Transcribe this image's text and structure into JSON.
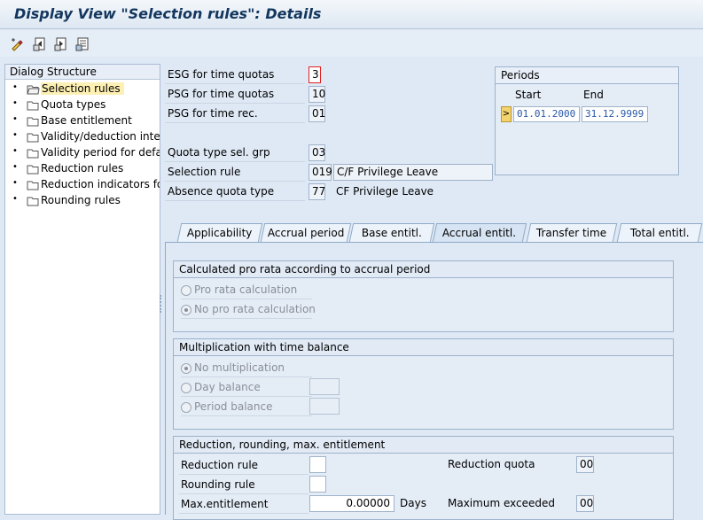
{
  "window": {
    "title": "Display View \"Selection rules\": Details"
  },
  "toolbar": {
    "buttons": [
      {
        "icon": "change-display-icon"
      },
      {
        "icon": "previous-entry-icon"
      },
      {
        "icon": "next-entry-icon"
      },
      {
        "icon": "variable-list-icon"
      }
    ]
  },
  "dialog_structure": {
    "header": "Dialog Structure",
    "items": [
      {
        "label": "Selection rules",
        "selected": true,
        "icon": "open-folder-icon"
      },
      {
        "label": "Quota types",
        "icon": "folder-icon"
      },
      {
        "label": "Base entitlement",
        "icon": "folder-icon"
      },
      {
        "label": "Validity/deduction interv",
        "icon": "folder-icon"
      },
      {
        "label": "Validity period for defaul",
        "icon": "folder-icon"
      },
      {
        "label": "Reduction rules",
        "icon": "folder-icon"
      },
      {
        "label": "Reduction indicators for",
        "icon": "folder-icon"
      },
      {
        "label": "Rounding rules",
        "icon": "folder-icon"
      }
    ]
  },
  "header_fields": {
    "esg": {
      "label": "ESG for time quotas",
      "value": "3"
    },
    "psg_quotas": {
      "label": "PSG for time quotas",
      "value": "10"
    },
    "psg_rec": {
      "label": "PSG for time rec.",
      "value": "01"
    },
    "quota_sel_grp": {
      "label": "Quota type sel. grp",
      "value": "03"
    },
    "selection_rule": {
      "label": "Selection rule",
      "value": "019",
      "desc": "C/F Privilege Leave"
    },
    "absence_quota": {
      "label": "Absence quota type",
      "value": "77",
      "desc": "CF Privilege Leave"
    }
  },
  "periods": {
    "header": "Periods",
    "start_label": "Start",
    "end_label": "End",
    "select_glyph": ">",
    "start": "01.01.2000",
    "end": "31.12.9999"
  },
  "tabs": [
    {
      "label": "Applicability"
    },
    {
      "label": "Accrual period"
    },
    {
      "label": "Base entitl."
    },
    {
      "label": "Accrual entitl.",
      "active": true
    },
    {
      "label": "Transfer time"
    },
    {
      "label": "Total entitl."
    }
  ],
  "pro_rata": {
    "header": "Calculated pro rata according to accrual period",
    "options": [
      {
        "label": "Pro rata calculation",
        "selected": false
      },
      {
        "label": "No pro rata calculation",
        "selected": true
      }
    ]
  },
  "multiplication": {
    "header": "Multiplication with time balance",
    "options": [
      {
        "label": "No multiplication",
        "selected": true
      },
      {
        "label": "Day balance",
        "selected": false
      },
      {
        "label": "Period balance",
        "selected": false
      }
    ]
  },
  "reduction": {
    "header": "Reduction, rounding, max. entitlement",
    "reduction_rule_label": "Reduction rule",
    "rounding_rule_label": "Rounding rule",
    "max_entitlement_label": "Max.entitlement",
    "max_entitlement_value": "0.00000",
    "days_unit": "Days",
    "reduction_quota_label": "Reduction quota",
    "reduction_quota_value": "00",
    "max_exceeded_label": "Maximum exceeded",
    "max_exceeded_value": "00"
  },
  "colors": {
    "title": "#13365e",
    "background": "#dfe9f5",
    "selected_item": "#fdf0b4",
    "date_text": "#2a58a8"
  }
}
